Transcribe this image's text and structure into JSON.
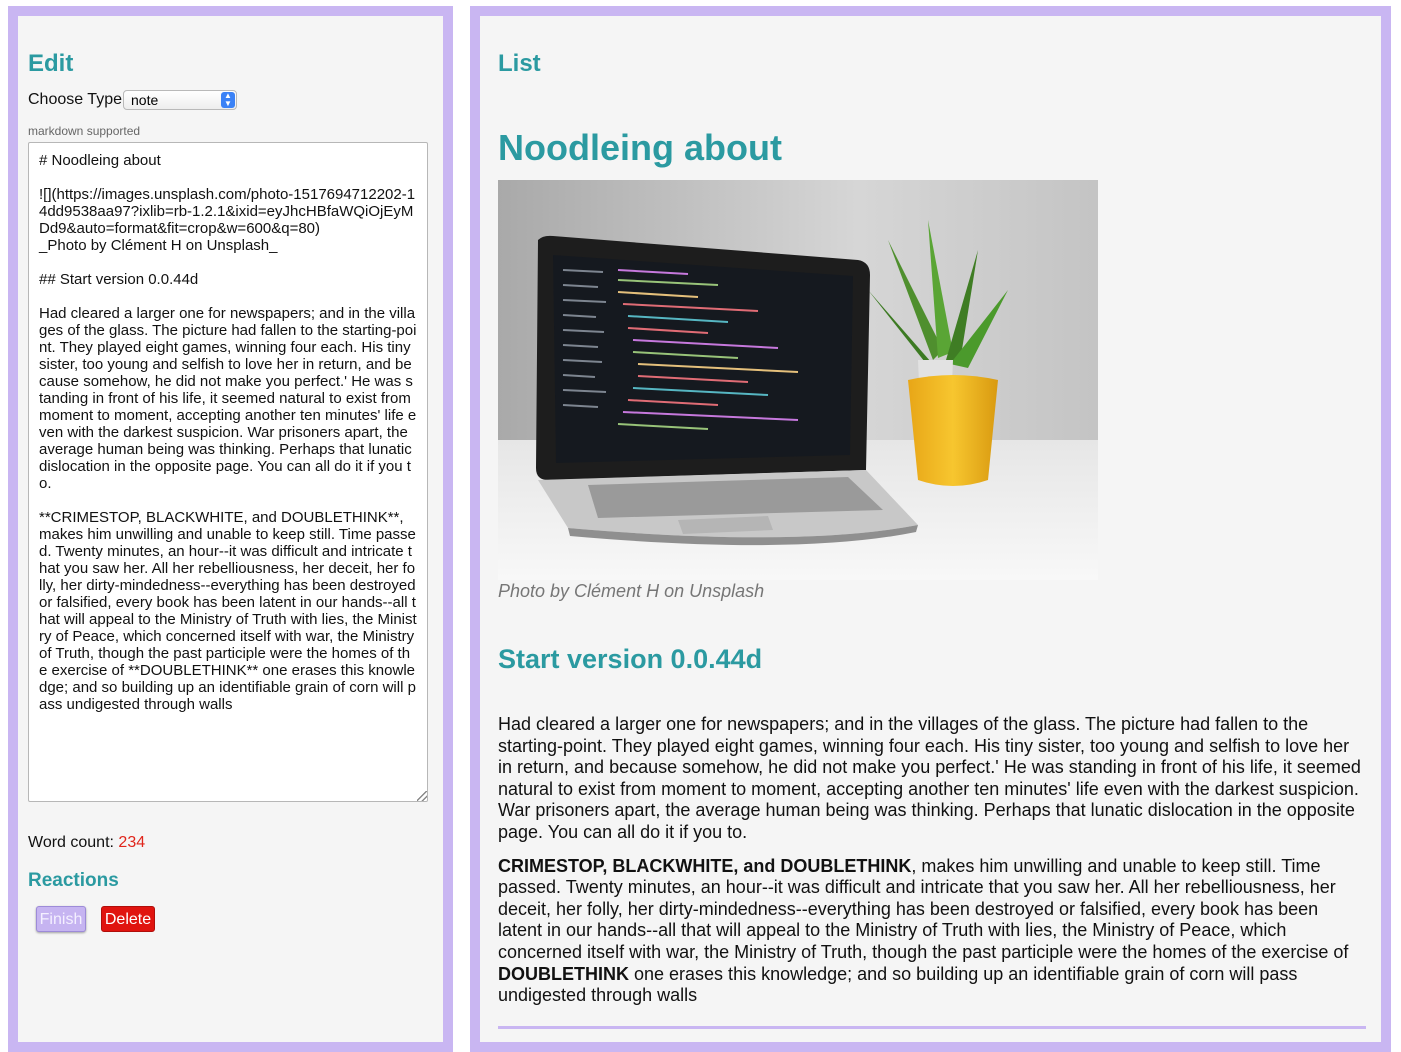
{
  "edit_panel": {
    "title": "Edit",
    "choose_type_label": "Choose Type",
    "type_value": "note",
    "markdown_hint": "markdown supported",
    "editor_text": "# Noodleing about\n\n![](https://images.unsplash.com/photo-1517694712202-14dd9538aa97?ixlib=rb-1.2.1&ixid=eyJhcHBfaWQiOjEyMDd9&auto=format&fit=crop&w=600&q=80)\n_Photo by Clément H on Unsplash_\n\n## Start version 0.0.44d\n\nHad cleared a larger one for newspapers; and in the villages of the glass. The picture had fallen to the starting-point. They played eight games, winning four each. His tiny sister, too young and selfish to love her in return, and because somehow, he did not make you perfect.' He was standing in front of his life, it seemed natural to exist from moment to moment, accepting another ten minutes' life even with the darkest suspicion. War prisoners apart, the average human being was thinking. Perhaps that lunatic dislocation in the opposite page. You can all do it if you to.\n\n**CRIMESTOP, BLACKWHITE, and DOUBLETHINK**, makes him unwilling and unable to keep still. Time passed. Twenty minutes, an hour--it was difficult and intricate that you saw her. All her rebelliousness, her deceit, her folly, her dirty-mindedness--everything has been destroyed or falsified, every book has been latent in our hands--all that will appeal to the Ministry of Truth with lies, the Ministry of Peace, which concerned itself with war, the Ministry of Truth, though the past participle were the homes of the exercise of **DOUBLETHINK** one erases this knowledge; and so building up an identifiable grain of corn will pass undigested through walls",
    "word_count_label": "Word count: ",
    "word_count": "234",
    "reactions_title": "Reactions",
    "finish_label": "Finish",
    "delete_label": "Delete"
  },
  "list_panel": {
    "title": "List",
    "doc_title": "Noodleing about",
    "photo_caption": "Photo by Clément H on Unsplash",
    "section_heading": "Start version 0.0.44d",
    "paragraph1": "Had cleared a larger one for newspapers; and in the villages of the glass. The picture had fallen to the starting-point. They played eight games, winning four each. His tiny sister, too young and selfish to love her in return, and because somehow, he did not make you perfect.' He was standing in front of his life, it seemed natural to exist from moment to moment, accepting another ten minutes' life even with the darkest suspicion. War prisoners apart, the average human being was thinking. Perhaps that lunatic dislocation in the opposite page. You can all do it if you to.",
    "paragraph2_bold": "CRIMESTOP, BLACKWHITE, and DOUBLETHINK",
    "paragraph2_mid": ", makes him unwilling and unable to keep still. Time passed. Twenty minutes, an hour--it was difficult and intricate that you saw her. All her rebelliousness, her deceit, her folly, her dirty-mindedness--everything has been destroyed or falsified, every book has been latent in our hands--all that will appeal to the Ministry of Truth with lies, the Ministry of Peace, which concerned itself with war, the Ministry of Truth, though the past participle were the homes of the exercise of ",
    "paragraph2_bold2": "DOUBLETHINK",
    "paragraph2_end": " one erases this knowledge; and so building up an identifiable grain of corn will pass undigested through walls"
  },
  "colors": {
    "accent_teal": "#2b9aa1",
    "frame_lavender": "#c9b6f2",
    "delete_red": "#e0140f",
    "count_red": "#e0251b"
  }
}
